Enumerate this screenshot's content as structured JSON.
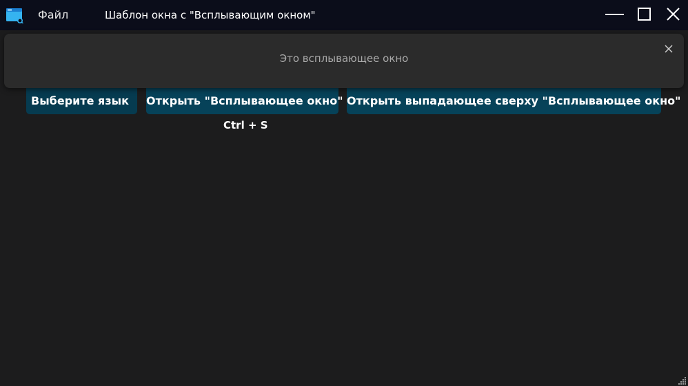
{
  "titlebar": {
    "menu_file": "Файл",
    "title": "Шаблон окна с \"Всплывающим окном\""
  },
  "icons": {
    "app": "window-app-icon",
    "minimize": "minimize-icon",
    "maximize": "maximize-icon",
    "close": "close-icon",
    "flyout_close": "close-icon",
    "resize": "resize-grip-icon"
  },
  "content": {
    "language_button": "Выберите язык",
    "open_popup_button": "Открыть \"Всплывающее окно\"",
    "open_dropdown_popup_button": "Открыть выпадающее сверху \"Всплывающее окно\"",
    "shortcut_hint": "Ctrl + S"
  },
  "flyout": {
    "message": "Это всплывающее окно"
  },
  "colors": {
    "titlebar_bg": "#0b0d1a",
    "window_bg": "#1c1c1d",
    "button_bg": "#064259",
    "flyout_bg": "#2b2b2b",
    "accent": "#29b6f6"
  }
}
